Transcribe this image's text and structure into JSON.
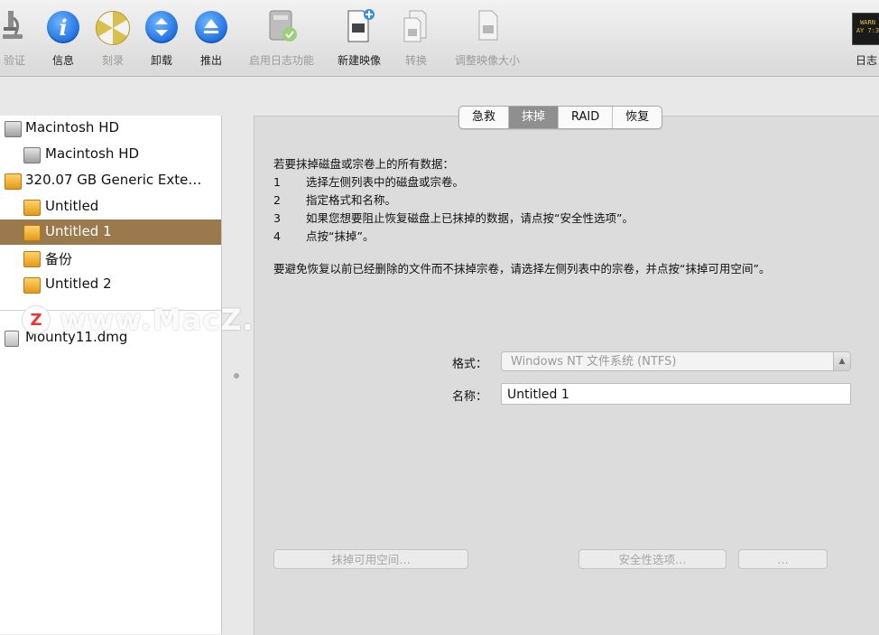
{
  "toolbar": {
    "items": [
      {
        "label": "验证",
        "icon": "microscope-icon"
      },
      {
        "label": "信息",
        "icon": "info-icon"
      },
      {
        "label": "刻录",
        "icon": "burn-icon"
      },
      {
        "label": "卸载",
        "icon": "unmount-icon"
      },
      {
        "label": "推出",
        "icon": "eject-icon"
      },
      {
        "label": "启用日志功能",
        "icon": "enable-journaling-icon"
      },
      {
        "label": "新建映像",
        "icon": "new-image-icon"
      },
      {
        "label": "转换",
        "icon": "convert-icon"
      },
      {
        "label": "调整映像大小",
        "icon": "resize-image-icon"
      },
      {
        "label": "日志",
        "icon": "log-icon"
      }
    ],
    "info_glyph": "i",
    "log_icon_text": "WARN\nAY 7:3"
  },
  "sidebar": {
    "items": [
      {
        "label": "Macintosh HD",
        "icon": "hard-drive-icon"
      },
      {
        "label": "Macintosh HD",
        "icon": "hard-drive-icon"
      },
      {
        "label": "320.07 GB Generic Exte…",
        "icon": "external-drive-icon"
      },
      {
        "label": "Untitled",
        "icon": "external-drive-icon"
      },
      {
        "label": "Untitled 1",
        "icon": "external-drive-icon",
        "selected": true
      },
      {
        "label": "备份",
        "icon": "external-drive-icon"
      },
      {
        "label": "Untitled 2",
        "icon": "external-drive-icon"
      },
      {
        "label": "Mounty11.dmg",
        "icon": "disk-image-icon"
      }
    ]
  },
  "watermark": {
    "badge": "Z",
    "text": "www.MacZ.com"
  },
  "tabs": [
    {
      "label": "急救"
    },
    {
      "label": "抹掉",
      "active": true
    },
    {
      "label": "RAID"
    },
    {
      "label": "恢复"
    }
  ],
  "instructions": {
    "heading": "若要抹掉磁盘或宗卷上的所有数据：",
    "steps": [
      {
        "num": "1",
        "text": "选择左侧列表中的磁盘或宗卷。"
      },
      {
        "num": "2",
        "text": "指定格式和名称。"
      },
      {
        "num": "3",
        "text": "如果您想要阻止恢复磁盘上已抹掉的数据，请点按“安全性选项”。"
      },
      {
        "num": "4",
        "text": "点按“抹掉”。"
      }
    ],
    "note": "要避免恢复以前已经删除的文件而不抹掉宗卷，请选择左侧列表中的宗卷，并点按“抹掉可用空间”。"
  },
  "form": {
    "format_label": "格式：",
    "format_value": "Windows NT 文件系统 (NTFS)",
    "name_label": "名称：",
    "name_value": "Untitled 1"
  },
  "buttons": {
    "erase_free_space": "抹掉可用空间…",
    "security_options": "安全性选项…",
    "erase": "…"
  }
}
